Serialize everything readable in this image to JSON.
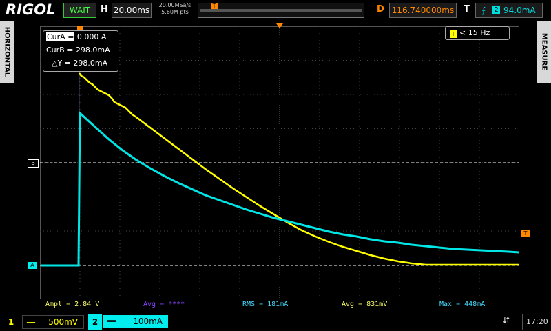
{
  "header": {
    "brand": "RIGOL",
    "run_status": "WAIT",
    "horizontal_label": "H",
    "timebase": "20.00ms",
    "sample_rate": "20.00MSa/s",
    "memory_depth": "5.60M pts",
    "delay_label": "D",
    "delay_value": "116.740000ms",
    "trigger_label": "T",
    "trigger_edge_icon": "rising-edge-icon",
    "trigger_source": "2",
    "trigger_level": "94.0mA"
  },
  "side_tabs": {
    "left": "HORIZONTAL",
    "right": "MEASURE"
  },
  "cursor": {
    "cura_label": "CurA =",
    "cura_value": "0.000 A",
    "curb_label": "CurB =",
    "curb_value": "298.0mA",
    "delta_label": "△Y =",
    "delta_value": "298.0mA"
  },
  "frequency": {
    "value": "< 15 Hz"
  },
  "markers": {
    "cursor_b": "B",
    "cursor_a": "A",
    "trigger": "T",
    "time_marker": "T"
  },
  "measurements": {
    "ampl": "Ampl = 2.84 V",
    "avg1": "Avg = ****",
    "rms": "RMS = 181mA",
    "avg2": "Avg = 831mV",
    "max": "Max = 448mA"
  },
  "channels": [
    {
      "number": "1",
      "coupling": "══",
      "scale": "500mV",
      "color": "#ffff00"
    },
    {
      "number": "2",
      "coupling": "══",
      "scale": "100mA",
      "color": "#00e5e5"
    }
  ],
  "status_bar": {
    "usb_icon": "usb-icon",
    "time": "17:20"
  },
  "colors": {
    "ch1": "#ffff00",
    "ch2": "#00e5e5",
    "accent": "#ff8800",
    "measure_ch1": "#ffff66",
    "measure_ch2": "#44ddff",
    "measure_avg": "#8844ff"
  }
}
